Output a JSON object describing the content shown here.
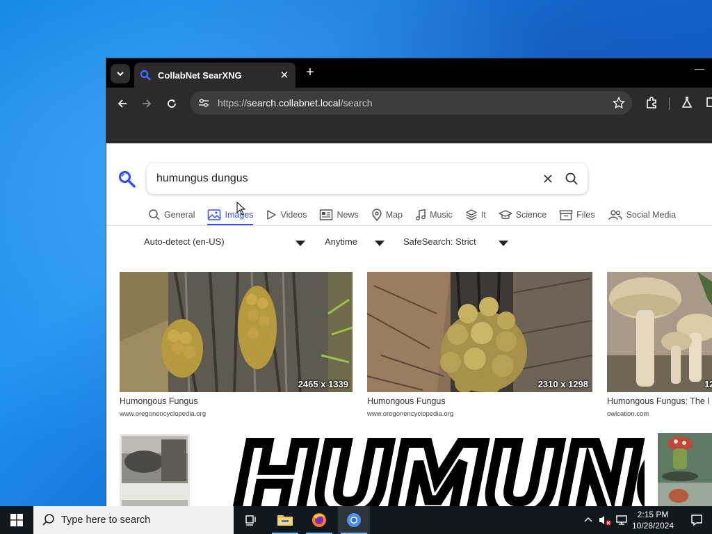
{
  "browser": {
    "tab": {
      "title": "CollabNet SearXNG",
      "icon": "search-icon"
    },
    "omnibox": {
      "scheme": "https://",
      "host": "search.collabnet.local",
      "path": "/search"
    }
  },
  "search": {
    "query": "humungus dungus",
    "categories": [
      {
        "label": "General",
        "icon": "search-icon",
        "active": false
      },
      {
        "label": "Images",
        "icon": "image-icon",
        "active": true
      },
      {
        "label": "Videos",
        "icon": "play-icon",
        "active": false
      },
      {
        "label": "News",
        "icon": "newspaper-icon",
        "active": false
      },
      {
        "label": "Map",
        "icon": "map-pin-icon",
        "active": false
      },
      {
        "label": "Music",
        "icon": "music-note-icon",
        "active": false
      },
      {
        "label": "It",
        "icon": "layers-icon",
        "active": false
      },
      {
        "label": "Science",
        "icon": "graduation-cap-icon",
        "active": false
      },
      {
        "label": "Files",
        "icon": "archive-icon",
        "active": false
      },
      {
        "label": "Social Media",
        "icon": "people-icon",
        "active": false
      }
    ],
    "filters": {
      "language": "Auto-detect (en-US)",
      "time": "Anytime",
      "safesearch": "SafeSearch: Strict"
    }
  },
  "results": [
    {
      "title": "Humongous Fungus",
      "url": "www.oregonencyclopedia.org",
      "size": "2465 x 1339"
    },
    {
      "title": "Humongous Fungus",
      "url": "www.oregonencyclopedia.org",
      "size": "2310 x 1298"
    },
    {
      "title": "Humongous Fungus: The l",
      "url": "owlcation.com",
      "size": "12"
    }
  ],
  "second_row": {
    "banner_text": "HUMUNGUS"
  },
  "taskbar": {
    "search_placeholder": "Type here to search",
    "time": "2:15 PM",
    "date": "10/28/2024"
  },
  "colors": {
    "accent": "#3050ff",
    "tab_bg": "#2b2b2b",
    "taskbar_bg": "#101820"
  }
}
